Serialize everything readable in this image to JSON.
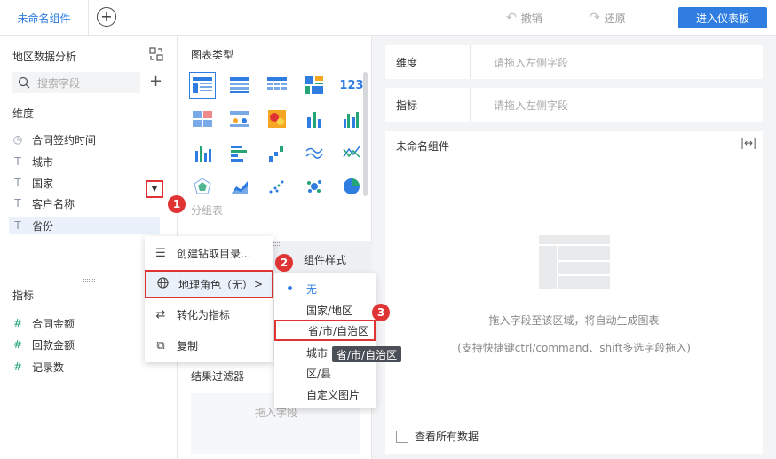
{
  "topbar": {
    "tab_label": "未命名组件",
    "undo_label": "撤销",
    "redo_label": "还原",
    "enter_button": "进入仪表板"
  },
  "left": {
    "dataset_title": "地区数据分析",
    "search_placeholder": "搜索字段",
    "dimension_title": "维度",
    "dimensions": [
      "合同签约时间",
      "城市",
      "国家",
      "客户名称",
      "省份"
    ],
    "measure_title": "指标",
    "measures": [
      "合同金额",
      "回款金额",
      "记录数"
    ]
  },
  "middle": {
    "chart_type_title": "图表类型",
    "group_label": "分组表",
    "style_tab": "组件样式",
    "filter_title": "结果过滤器",
    "filter_placeholder": "拖入字段"
  },
  "right": {
    "dimension_label": "维度",
    "dimension_placeholder": "请拖入左侧字段",
    "measure_label": "指标",
    "measure_placeholder": "请拖入左侧字段",
    "canvas_title": "未命名组件",
    "hint_main": "拖入字段至该区域，将自动生成图表",
    "hint_sub": "(支持快捷键ctrl/command、shift多选字段拖入)",
    "view_all": "查看所有数据"
  },
  "context_menu": {
    "items": [
      "创建钻取目录...",
      "地理角色（无）",
      "转化为指标",
      "复制"
    ]
  },
  "geo_submenu": {
    "items": [
      "无",
      "国家/地区",
      "省/市/自治区",
      "城市",
      "区/县",
      "自定义图片"
    ],
    "selected": "无",
    "tooltip": "省/市/自治区"
  },
  "badges": [
    "1",
    "2",
    "3"
  ],
  "colors": {
    "accent": "#2f7de1",
    "highlight": "#e03333"
  }
}
